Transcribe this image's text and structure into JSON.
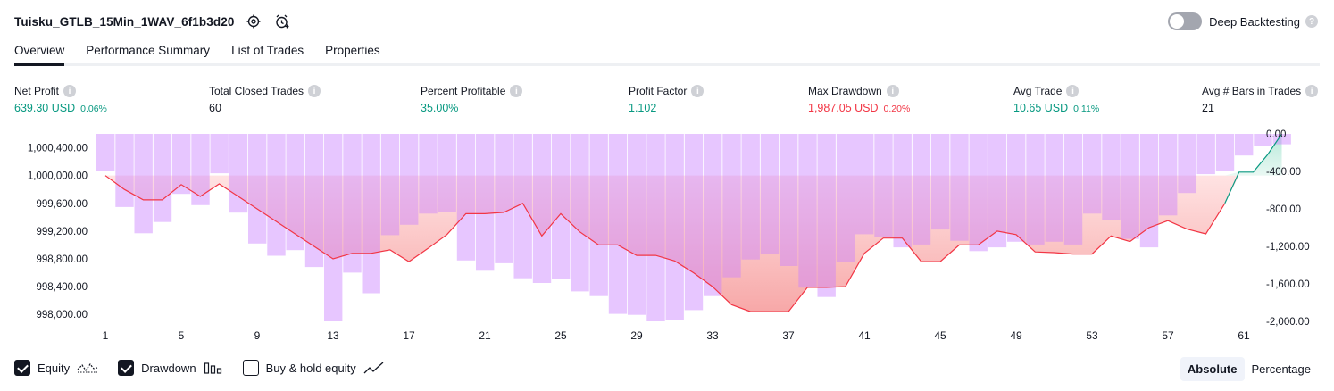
{
  "header": {
    "title": "Tuisku_GTLB_15Min_1WAV_6f1b3d20",
    "deep_backtesting_label": "Deep Backtesting",
    "deep_backtesting_enabled": false
  },
  "tabs": [
    {
      "label": "Overview",
      "active": true
    },
    {
      "label": "Performance Summary",
      "active": false
    },
    {
      "label": "List of Trades",
      "active": false
    },
    {
      "label": "Properties",
      "active": false
    }
  ],
  "metrics": {
    "net_profit": {
      "label": "Net Profit",
      "value": "639.30 USD",
      "pct": "0.06%"
    },
    "total_closed_trades": {
      "label": "Total Closed Trades",
      "value": "60"
    },
    "percent_profitable": {
      "label": "Percent Profitable",
      "value": "35.00%"
    },
    "profit_factor": {
      "label": "Profit Factor",
      "value": "1.102"
    },
    "max_drawdown": {
      "label": "Max Drawdown",
      "value": "1,987.05 USD",
      "pct": "0.20%"
    },
    "avg_trade": {
      "label": "Avg Trade",
      "value": "10.65 USD",
      "pct": "0.11%"
    },
    "avg_bars": {
      "label": "Avg # Bars in Trades",
      "value": "21"
    }
  },
  "colors": {
    "profit_green": "#089981",
    "loss_red": "#f23645",
    "drawdown_bar": "#d9b3ff",
    "equity_line_loss": "#f23645",
    "equity_line_gain": "#089981"
  },
  "chart_data": {
    "type": "bar",
    "x_ticks": [
      "1",
      "5",
      "9",
      "13",
      "17",
      "21",
      "25",
      "29",
      "33",
      "37",
      "41",
      "45",
      "49",
      "53",
      "57",
      "61"
    ],
    "left_axis_ticks": [
      "1,000,400.00",
      "1,000,000.00",
      "999,600.00",
      "999,200.00",
      "998,800.00",
      "998,400.00",
      "998,000.00"
    ],
    "right_axis_ticks": [
      "0.00",
      "-400.00",
      "-800.00",
      "-1,200.00",
      "-1,600.00",
      "-2,000.00"
    ],
    "equity_ylim": [
      997900,
      1000600
    ],
    "drawdown_ylim": [
      -2000,
      0
    ],
    "series": [
      {
        "name": "Equity",
        "values": [
          1000000,
          999800,
          999650,
          999650,
          999870,
          999700,
          999880,
          999700,
          999520,
          999340,
          999160,
          998980,
          998800,
          998880,
          998880,
          998930,
          998760,
          998950,
          999150,
          999450,
          999450,
          999470,
          999600,
          999130,
          999450,
          999190,
          999000,
          999000,
          998850,
          998850,
          998770,
          998600,
          998400,
          998140,
          998040,
          998040,
          998040,
          998390,
          998390,
          998400,
          998880,
          999100,
          999100,
          998760,
          998760,
          999000,
          999000,
          999200,
          999150,
          998900,
          998890,
          998870,
          998870,
          999130,
          999050,
          999250,
          999350,
          999230,
          999160,
          999600,
          1000050,
          1000050,
          1000300,
          1000600
        ]
      },
      {
        "name": "Drawdown",
        "values": [
          -400,
          -780,
          -1060,
          -940,
          -640,
          -760,
          -420,
          -840,
          -1170,
          -1300,
          -1240,
          -1420,
          -2000,
          -1480,
          -1700,
          -1080,
          -970,
          -850,
          -830,
          -1350,
          -1460,
          -1380,
          -1540,
          -1590,
          -1550,
          -1680,
          -1730,
          -1920,
          -1930,
          -2000,
          -1990,
          -1880,
          -1730,
          -1530,
          -1340,
          -1280,
          -1410,
          -1640,
          -1740,
          -1370,
          -1070,
          -1100,
          -1210,
          -1180,
          -1020,
          -1140,
          -1250,
          -1210,
          -1150,
          -1180,
          -1150,
          -1180,
          -850,
          -920,
          -1120,
          -1210,
          -870,
          -630,
          -430,
          -400,
          -230,
          -130,
          -110
        ]
      }
    ]
  },
  "footer": {
    "equity_label": "Equity",
    "equity_checked": true,
    "drawdown_label": "Drawdown",
    "drawdown_checked": true,
    "buy_hold_label": "Buy & hold equity",
    "buy_hold_checked": false,
    "absolute_label": "Absolute",
    "percentage_label": "Percentage"
  }
}
